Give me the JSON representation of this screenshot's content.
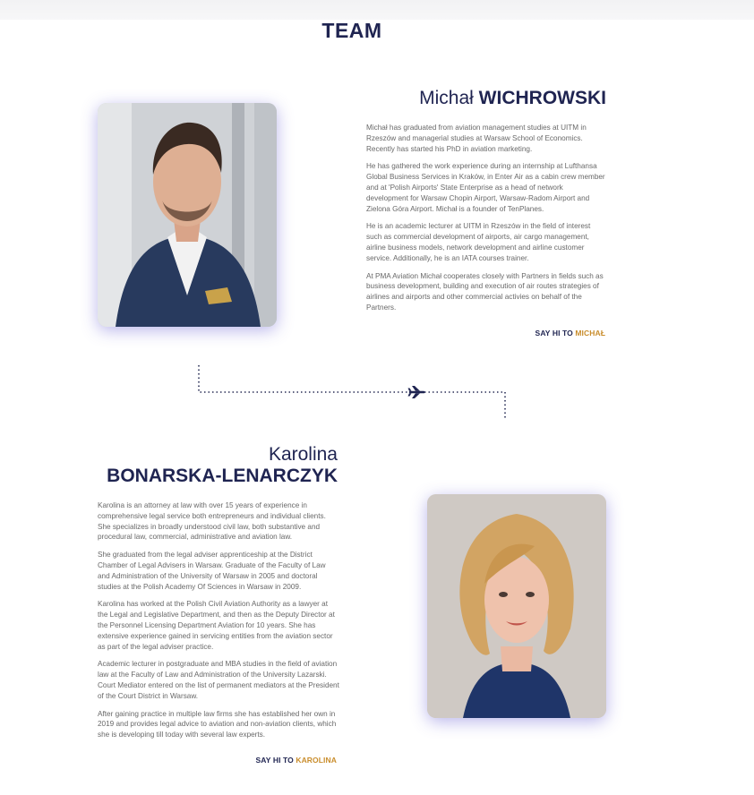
{
  "section": {
    "title": "TEAM"
  },
  "members": [
    {
      "first_name": "Michał",
      "last_name": "WICHROWSKI",
      "bio": [
        "Michał has graduated from aviation management studies at UITM in Rzeszów and managerial studies at Warsaw School of Economics. Recently has started his PhD in aviation marketing.",
        "He has gathered the work experience during an internship at Lufthansa Global Business Services in Kraków, in Enter Air as a cabin crew member and at 'Polish Airports' State Enterprise as a head of network development for Warsaw Chopin Airport, Warsaw-Radom Airport and Zielona Góra Airport. Michał is a founder of TenPlanes.",
        "He is an academic lecturer at UITM in Rzeszów in the field of interest such as commercial development of airports, air cargo management, airline business models, network development and airline customer service. Additionally, he is an IATA courses trainer.",
        "At PMA Aviation Michał cooperates closely with Partners in fields such as business development, building and execution of air routes strategies of airlines and airports and other commercial activies on behalf of the Partners."
      ],
      "cta_prefix": "SAY HI TO",
      "cta_name": "MICHAŁ"
    },
    {
      "first_name": "Karolina",
      "last_name": "BONARSKA-LENARCZYK",
      "bio": [
        "Karolina is an attorney at law with over 15 years of experience in comprehensive legal service both entrepreneurs and individual clients. She specializes in broadly understood civil law, both substantive and procedural law, commercial, administrative and aviation law.",
        "She graduated from the legal adviser apprenticeship at the District Chamber of Legal Advisers in Warsaw. Graduate of the Faculty of Law and Administration of the University of Warsaw in 2005 and doctoral studies at the Polish Academy Of Sciences in Warsaw in 2009.",
        "Karolina has worked at the Polish Civil Aviation Authority as a lawyer at the Legal and Legislative Department, and then as the Deputy Director at the Personnel Licensing Department Aviation for 10 years. She has extensive experience gained in servicing entities from the aviation sector as part of the legal adviser practice.",
        "Academic lecturer in postgraduate and MBA studies in the field of aviation law at the Faculty of Law and Administration of the University Lazarski. Court Mediator entered on the list of permanent mediators at the President of the Court District in Warsaw.",
        "After gaining practice in multiple law firms she has established her own in 2019 and provides legal advice to aviation and non-aviation clients, which she is developing till today with several law experts."
      ],
      "cta_prefix": "SAY HI TO",
      "cta_name": "KAROLINA"
    }
  ],
  "icons": {
    "route": "airplane-icon"
  },
  "colors": {
    "navy": "#1f2451",
    "accent": "#c98d2c",
    "body_text": "#686868"
  }
}
